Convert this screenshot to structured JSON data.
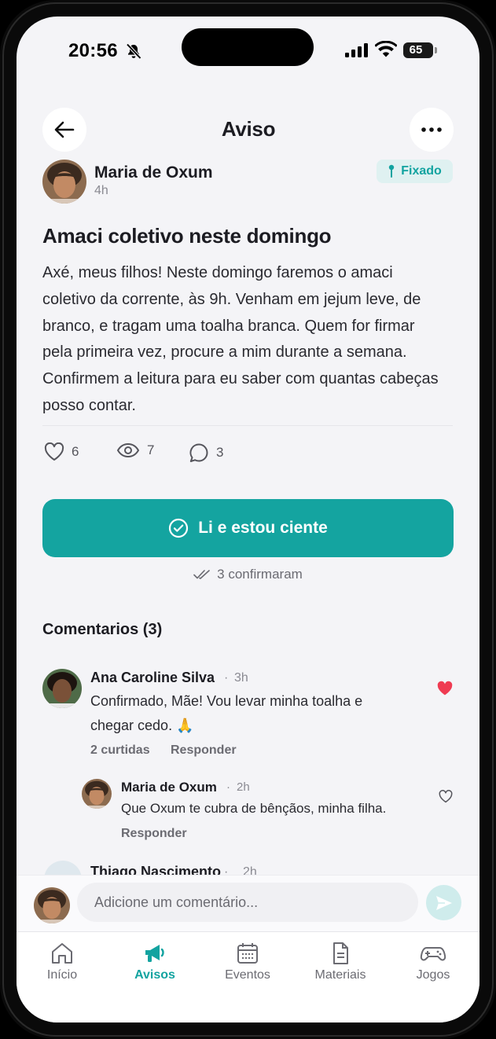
{
  "status_bar": {
    "time": "20:56",
    "battery": "65",
    "battery_level": 0.65
  },
  "header": {
    "title": "Aviso"
  },
  "post": {
    "author": "Maria de Oxum",
    "time": "4h",
    "badge": "Fixado",
    "title": "Amaci coletivo neste domingo",
    "body": "Axé, meus filhos! Neste domingo faremos o amaci coletivo da corrente, às 9h. Venham em jejum leve, de branco, e tragam uma toalha branca. Quem for firmar pela primeira vez, procure a mim durante a semana. Confirmem a leitura para eu saber com quantas cabeças posso contar.",
    "likes": "6",
    "views": "7",
    "comments": "3"
  },
  "confirm": {
    "button_label": "Li e estou ciente",
    "confirmed_text": "3 confirmaram"
  },
  "comments_section": {
    "title": "Comentarios (3)",
    "items": [
      {
        "author": "Ana Caroline Silva",
        "separator": "·",
        "time": "3h",
        "text_line1": "Confirmado, Mãe! Vou levar minha toalha e",
        "text_line2": "chegar cedo. 🙏",
        "likes": "2 curtidas",
        "reply": "Responder"
      },
      {
        "author": "Maria de Oxum",
        "separator": "·",
        "time": "2h",
        "text": "Que Oxum te cubra de bênçãos, minha filha.",
        "reply": "Responder"
      },
      {
        "author": "Thiago Nascimento",
        "separator": "·",
        "time": "2h"
      }
    ]
  },
  "composer": {
    "placeholder": "Adicione um comentário..."
  },
  "tabbar": {
    "items": [
      {
        "label": "Início"
      },
      {
        "label": "Avisos"
      },
      {
        "label": "Eventos"
      },
      {
        "label": "Materiais"
      },
      {
        "label": "Jogos"
      }
    ]
  },
  "colors": {
    "accent": "#14a4a0",
    "accent_light": "#dff1f1",
    "heart": "#ef3b52",
    "background": "#f4f4f7"
  }
}
